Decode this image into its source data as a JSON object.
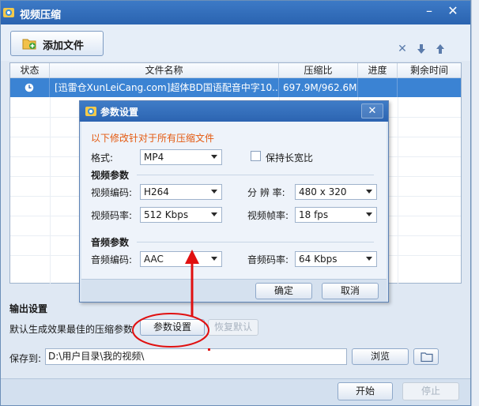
{
  "window": {
    "title": "视频压缩",
    "minimize_icon": "minimize-icon",
    "close_icon": "close-icon"
  },
  "toolbar": {
    "add_file_label": "添加文件",
    "icons": [
      "delete-icon",
      "move-down-icon",
      "move-up-icon"
    ]
  },
  "file_list": {
    "columns": [
      "状态",
      "文件名称",
      "压缩比",
      "进度",
      "剩余时间"
    ],
    "rows": [
      {
        "status_icon": "clock-icon",
        "name": "[迅雷仓XunLeiCang.com]超体BD国语配音中字10...",
        "ratio": "697.9M/962.6M",
        "progress": "",
        "remaining": ""
      }
    ]
  },
  "output": {
    "title": "输出设置",
    "description": "默认生成效果最佳的压缩参数",
    "params_button": "参数设置",
    "restore_button": "恢复默认",
    "save_label": "保存到:",
    "save_path": "D:\\用户目录\\我的视频\\",
    "browse_button": "浏览",
    "folder_icon": "folder-icon"
  },
  "footer": {
    "start_button": "开始",
    "stop_button": "停止"
  },
  "dialog": {
    "title": "参数设置",
    "note": "以下修改针对于所有压缩文件",
    "format_label": "格式:",
    "format_value": "MP4",
    "keep_ratio_label": "保持长宽比",
    "keep_ratio_checked": false,
    "video_group": "视频参数",
    "video_codec_label": "视频编码:",
    "video_codec_value": "H264",
    "resolution_label": "分 辨 率:",
    "resolution_value": "480 x 320",
    "video_bitrate_label": "视频码率:",
    "video_bitrate_value": "512 Kbps",
    "framerate_label": "视频帧率:",
    "framerate_value": "18 fps",
    "audio_group": "音频参数",
    "audio_codec_label": "音频编码:",
    "audio_codec_value": "AAC",
    "audio_bitrate_label": "音频码率:",
    "audio_bitrate_value": "64 Kbps",
    "ok_button": "确定",
    "cancel_button": "取消"
  },
  "colors": {
    "title_bar": "#2a63b0",
    "selected_row": "#3b83d3",
    "note_text": "#e4590f",
    "annotation_red": "#e01010"
  }
}
